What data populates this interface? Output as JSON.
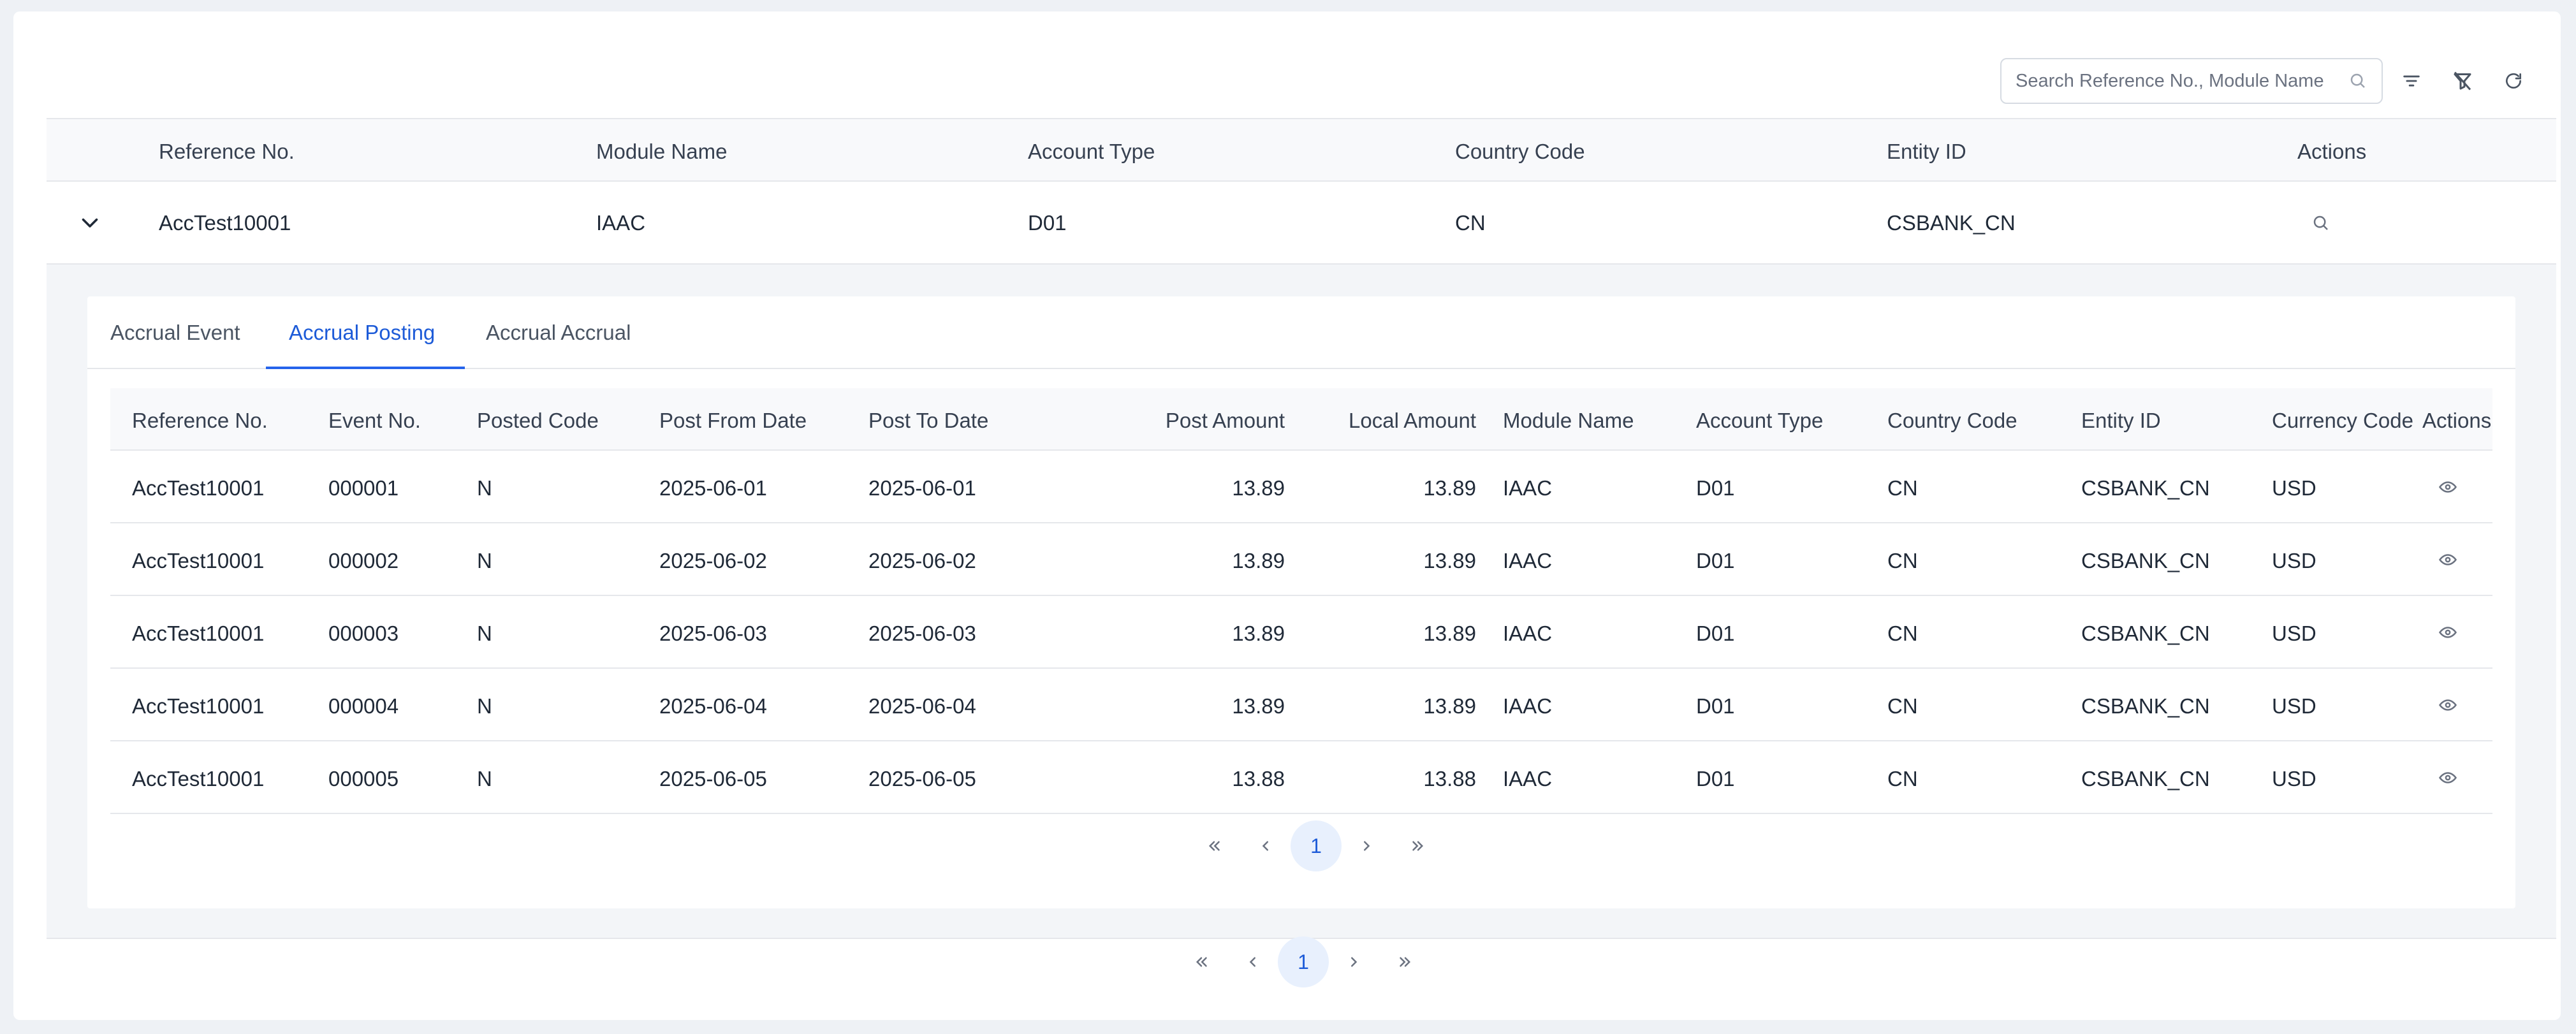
{
  "search": {
    "placeholder": "Search Reference No., Module Name"
  },
  "toolbar_icons": [
    "filter-icon",
    "clear-filter-icon",
    "refresh-icon"
  ],
  "outer_table": {
    "columns": [
      "Reference No.",
      "Module Name",
      "Account Type",
      "Country Code",
      "Entity ID",
      "Actions"
    ],
    "row": {
      "reference_no": "AccTest10001",
      "module_name": "IAAC",
      "account_type": "D01",
      "country_code": "CN",
      "entity_id": "CSBANK_CN"
    }
  },
  "tabs": [
    {
      "label": "Accrual Event",
      "active": false
    },
    {
      "label": "Accrual Posting",
      "active": true
    },
    {
      "label": "Accrual Accrual",
      "active": false
    }
  ],
  "inner_table": {
    "columns": [
      "Reference No.",
      "Event No.",
      "Posted Code",
      "Post From Date",
      "Post To Date",
      "Post Amount",
      "Local Amount",
      "Module Name",
      "Account Type",
      "Country Code",
      "Entity ID",
      "Currency Code",
      "Actions"
    ],
    "rows": [
      [
        "AccTest10001",
        "000001",
        "N",
        "2025-06-01",
        "2025-06-01",
        "13.89",
        "13.89",
        "IAAC",
        "D01",
        "CN",
        "CSBANK_CN",
        "USD"
      ],
      [
        "AccTest10001",
        "000002",
        "N",
        "2025-06-02",
        "2025-06-02",
        "13.89",
        "13.89",
        "IAAC",
        "D01",
        "CN",
        "CSBANK_CN",
        "USD"
      ],
      [
        "AccTest10001",
        "000003",
        "N",
        "2025-06-03",
        "2025-06-03",
        "13.89",
        "13.89",
        "IAAC",
        "D01",
        "CN",
        "CSBANK_CN",
        "USD"
      ],
      [
        "AccTest10001",
        "000004",
        "N",
        "2025-06-04",
        "2025-06-04",
        "13.89",
        "13.89",
        "IAAC",
        "D01",
        "CN",
        "CSBANK_CN",
        "USD"
      ],
      [
        "AccTest10001",
        "000005",
        "N",
        "2025-06-05",
        "2025-06-05",
        "13.88",
        "13.88",
        "IAAC",
        "D01",
        "CN",
        "CSBANK_CN",
        "USD"
      ]
    ]
  },
  "inner_pager": {
    "current_page": "1"
  },
  "outer_pager": {
    "current_page": "1"
  },
  "colors": {
    "accent": "#1d5bd8",
    "page_bg": "#eef1f5",
    "header_bg": "#f8f9fb"
  }
}
